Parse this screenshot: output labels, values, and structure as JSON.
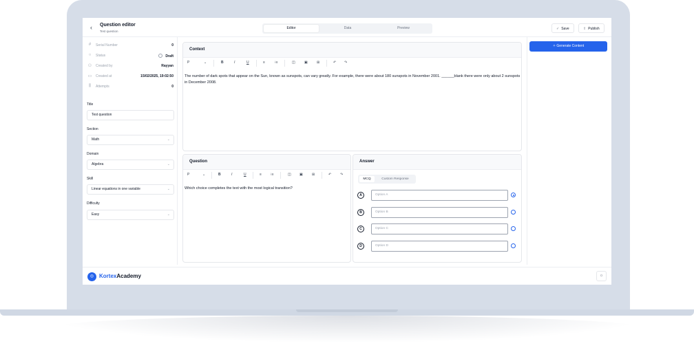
{
  "header": {
    "back_icon": "‹",
    "title": "Question editor",
    "subtitle": "Test question",
    "tabs": [
      "Editor",
      "Data",
      "Preview"
    ],
    "active_tab": "Editor",
    "save_label": "Save",
    "publish_label": "Publish"
  },
  "meta": {
    "serial_label": "Serial Number",
    "serial_value": "0",
    "status_label": "Status",
    "status_value": "Draft",
    "created_by_label": "Created by",
    "created_by_value": "Rayyan",
    "created_at_label": "Created at",
    "created_at_value": "15/02/2025, 19:02:50",
    "attempts_label": "Attempts",
    "attempts_value": "0"
  },
  "fields": {
    "title_label": "Title",
    "title_value": "Test question",
    "section_label": "Section",
    "section_value": "Math",
    "domain_label": "Domain",
    "domain_value": "Algebra",
    "skill_label": "Skill",
    "skill_value": "Linear equations in one variable",
    "difficulty_label": "Difficulty",
    "difficulty_value": "Easy"
  },
  "toolbar": {
    "para": "P",
    "bold": "B",
    "italic": "I",
    "underline": "U",
    "bullets": "≡",
    "numbers": "⁝≡",
    "img1": "◫",
    "img2": "▣",
    "table": "⊞",
    "undo": "↶",
    "redo": "↷"
  },
  "context": {
    "title": "Context",
    "text": "The number of dark spots that appear on the Sun, known as sunspots, can vary greatly. For example, there were about 180 sunspots in November 2001. ______blank there were only about 2 sunspots in December 2008."
  },
  "question": {
    "title": "Question",
    "text": "Which choice completes the text with the most logical transition?"
  },
  "answer": {
    "title": "Answer",
    "tab_mcq": "MCQ",
    "tab_custom": "Custom Response",
    "options": [
      {
        "letter": "A",
        "placeholder": "Option A",
        "selected": true
      },
      {
        "letter": "B",
        "placeholder": "Option B",
        "selected": false
      },
      {
        "letter": "C",
        "placeholder": "Option C",
        "selected": false
      },
      {
        "letter": "D",
        "placeholder": "Option D",
        "selected": false
      }
    ]
  },
  "right": {
    "generate_label": "Generate Content"
  },
  "footer": {
    "brand_part1": "Kortex",
    "brand_part2": "Academy"
  },
  "colors": {
    "accent": "#2563eb"
  }
}
